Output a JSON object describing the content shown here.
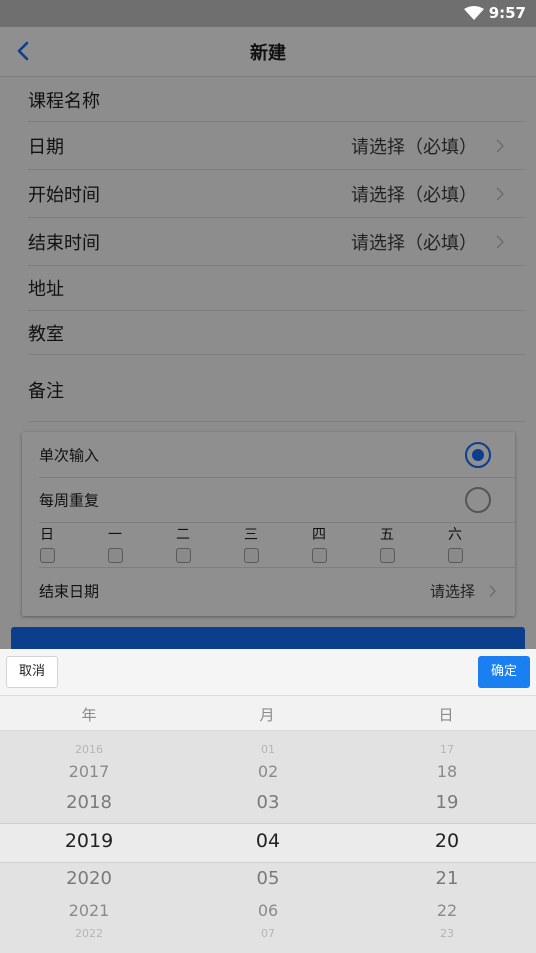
{
  "status_bar": {
    "time": "9:57"
  },
  "header": {
    "title": "新建"
  },
  "form": {
    "course_name": "课程名称",
    "date": {
      "label": "日期",
      "value": "请选择（必填）"
    },
    "start_time": {
      "label": "开始时间",
      "value": "请选择（必填）"
    },
    "end_time": {
      "label": "结束时间",
      "value": "请选择（必填）"
    },
    "address": "地址",
    "classroom": "教室",
    "note": "备注"
  },
  "repeat": {
    "single": "单次输入",
    "weekly": "每周重复",
    "selected": "single",
    "weekdays": [
      "日",
      "一",
      "二",
      "三",
      "四",
      "五",
      "六"
    ],
    "end_date": {
      "label": "结束日期",
      "value": "请选择"
    }
  },
  "picker": {
    "cancel": "取消",
    "confirm": "确定",
    "columns": [
      "年",
      "月",
      "日"
    ],
    "years": [
      "2016",
      "2017",
      "2018",
      "2019",
      "2020",
      "2021",
      "2022"
    ],
    "months": [
      "01",
      "02",
      "03",
      "04",
      "05",
      "06",
      "07"
    ],
    "days": [
      "17",
      "18",
      "19",
      "20",
      "21",
      "22",
      "23"
    ],
    "selected": {
      "year": "2019",
      "month": "04",
      "day": "20"
    }
  },
  "colors": {
    "accent": "#1a80f2",
    "primary_dark": "#0b3f8e"
  }
}
